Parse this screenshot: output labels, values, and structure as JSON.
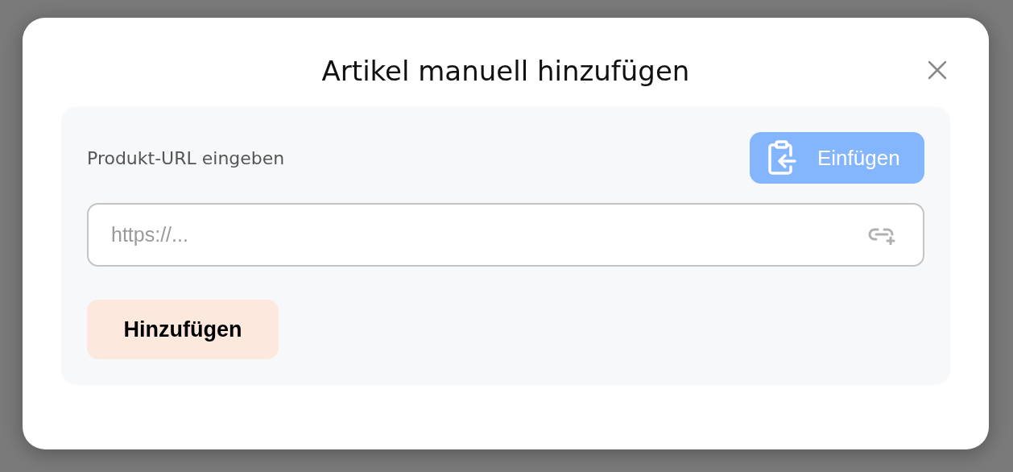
{
  "dialog": {
    "title": "Artikel manuell hinzufügen"
  },
  "form": {
    "label": "Produkt-URL eingeben",
    "paste_button": "Einfügen",
    "url_field": {
      "placeholder": "https://..."
    },
    "submit_button": "Hinzufügen"
  }
}
